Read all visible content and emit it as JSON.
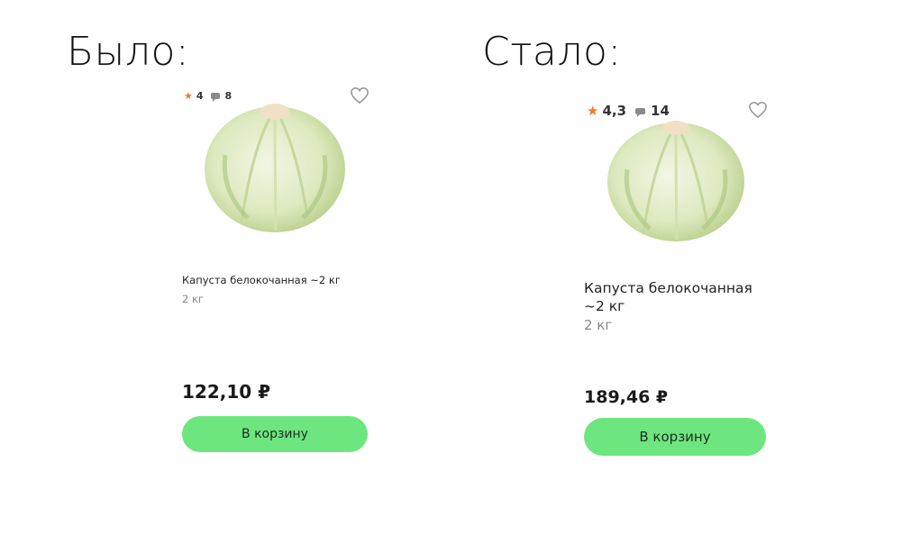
{
  "headings": {
    "before": "Было:",
    "after": "Стало:"
  },
  "cards": {
    "before": {
      "rating": "4",
      "reviews": "8",
      "title": "Капуста белокочанная ~2 кг",
      "weight": "2 кг",
      "price": "122,10 ₽",
      "button": "В корзину"
    },
    "after": {
      "rating": "4,3",
      "reviews": "14",
      "title": "Капуста белокочанная ~2 кг",
      "weight": "2 кг",
      "price": "189,46 ₽",
      "button": "В корзину"
    }
  },
  "colors": {
    "accent_button": "#6ee680",
    "star": "#f07a2a"
  },
  "icons": {
    "favorite": "heart-outline-icon",
    "rating": "star-icon",
    "reviews": "comment-icon"
  }
}
